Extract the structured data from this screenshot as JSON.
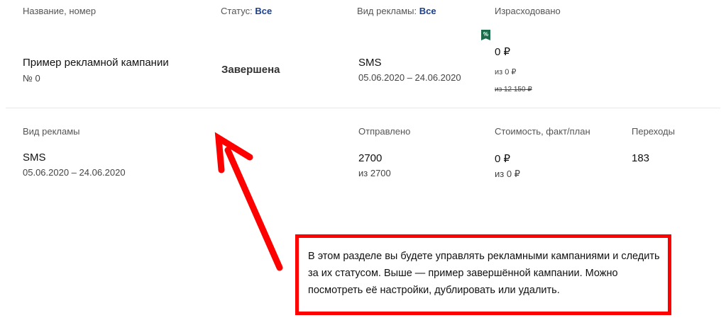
{
  "header": {
    "name_col": "Название, номер",
    "status_col": "Статус:",
    "status_filter": "Все",
    "type_col": "Вид рекламы:",
    "type_filter": "Все",
    "spent_col": "Израсходовано"
  },
  "campaign": {
    "name": "Пример рекламной кампании",
    "number": "№ 0",
    "status": "Завершена",
    "ad_type": "SMS",
    "dates": "05.06.2020 – 24.06.2020",
    "badge": "%",
    "spent": "0 ₽",
    "spent_of": "из 0 ₽",
    "spent_old": "из 12 150 ₽"
  },
  "details": {
    "headers": {
      "type": "Вид рекламы",
      "sent": "Отправлено",
      "cost": "Стоимость, факт/план",
      "clicks": "Переходы"
    },
    "row": {
      "type": "SMS",
      "dates": "05.06.2020 – 24.06.2020",
      "sent": "2700",
      "sent_of": "из 2700",
      "cost": "0 ₽",
      "cost_of": "из 0 ₽",
      "clicks": "183"
    }
  },
  "annotation": {
    "text": "В этом разделе вы будете управлять рекламными кампаниями и следить за их статусом. Выше — пример завершённой кампании. Можно посмотреть её настройки, дублировать или удалить.",
    "color": "#ff0000"
  }
}
